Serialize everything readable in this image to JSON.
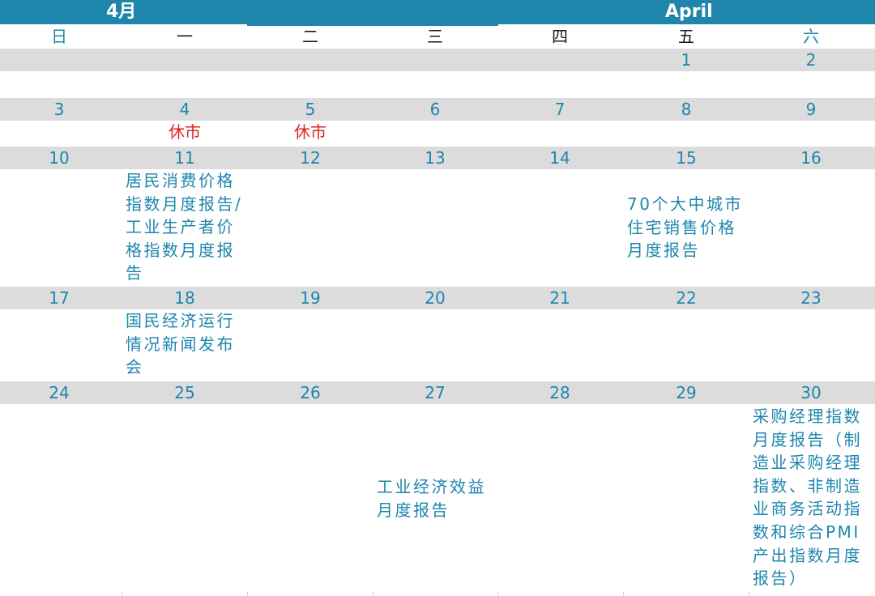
{
  "header": {
    "month_cn": "4月",
    "month_en": "April"
  },
  "weekdays": [
    "日",
    "一",
    "二",
    "三",
    "四",
    "五",
    "六"
  ],
  "weeks": [
    {
      "dates": [
        "",
        "",
        "",
        "",
        "",
        "1",
        "2"
      ]
    },
    {
      "dates": [
        "3",
        "4",
        "5",
        "6",
        "7",
        "8",
        "9"
      ]
    },
    {
      "dates": [
        "10",
        "11",
        "12",
        "13",
        "14",
        "15",
        "16"
      ]
    },
    {
      "dates": [
        "17",
        "18",
        "19",
        "20",
        "21",
        "22",
        "23"
      ]
    },
    {
      "dates": [
        "24",
        "25",
        "26",
        "27",
        "28",
        "29",
        "30"
      ]
    }
  ],
  "holidays": {
    "apr4": "休市",
    "apr5": "休市"
  },
  "events": {
    "apr11": "居民消费价格指数月度报告/工业生产者价格指数月度报告",
    "apr15": "70个大中城市住宅销售价格月度报告",
    "apr18": "国民经济运行情况新闻发布会",
    "apr27": "工业经济效益月度报告",
    "apr30": "采购经理指数月度报告（制造业采购经理指数、非制造业商务活动指数和综合PMI产出指数月度报告）"
  },
  "colors": {
    "header": "#1f86ab",
    "band": "#dcdcdc",
    "text": "#1e86ad",
    "holiday": "#e02020"
  }
}
